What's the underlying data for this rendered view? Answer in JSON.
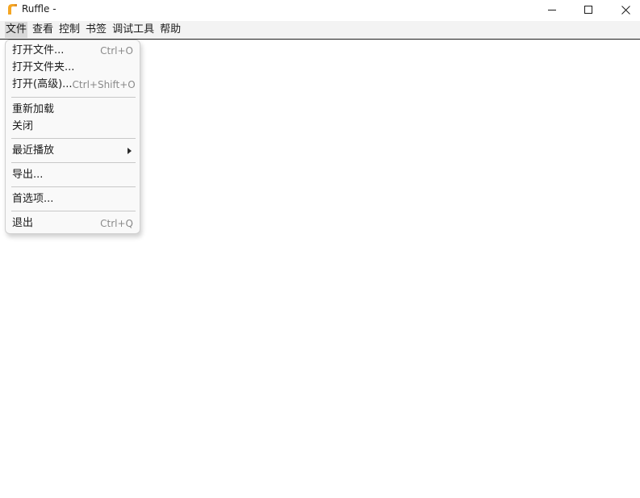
{
  "window": {
    "title": "Ruffle -"
  },
  "menubar": {
    "items": [
      {
        "label": "文件",
        "active": true
      },
      {
        "label": "查看"
      },
      {
        "label": "控制"
      },
      {
        "label": "书签"
      },
      {
        "label": "调试工具"
      },
      {
        "label": "帮助"
      }
    ]
  },
  "file_menu": {
    "open_file": {
      "label": "打开文件...",
      "shortcut": "Ctrl+O"
    },
    "open_folder": {
      "label": "打开文件夹..."
    },
    "open_advanced": {
      "label": "打开(高级)...",
      "shortcut": "Ctrl+Shift+O"
    },
    "reload": {
      "label": "重新加载"
    },
    "close": {
      "label": "关闭"
    },
    "recent": {
      "label": "最近播放"
    },
    "export": {
      "label": "导出..."
    },
    "preferences": {
      "label": "首选项..."
    },
    "exit": {
      "label": "退出",
      "shortcut": "Ctrl+Q"
    }
  },
  "colors": {
    "accent_icon": "#f5a623",
    "menubar_bg": "#f3f3f3",
    "active_menu_bg": "#d9d9d9"
  }
}
